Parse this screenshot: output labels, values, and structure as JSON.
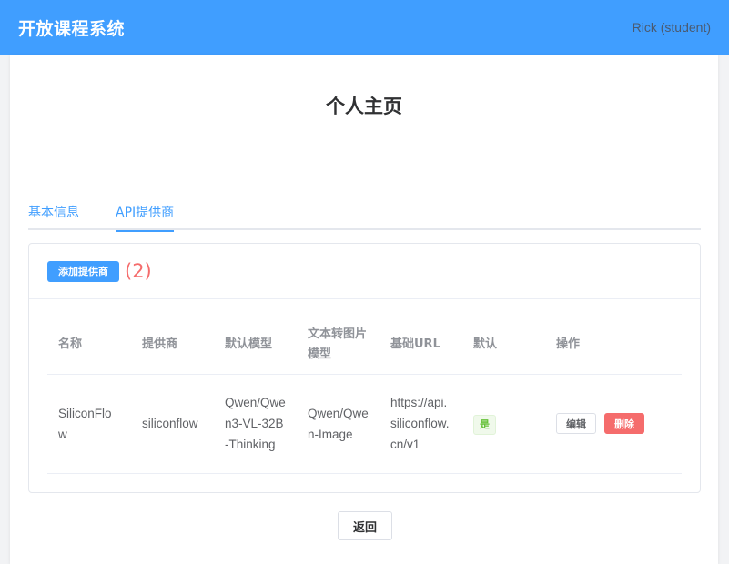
{
  "header": {
    "app_title": "开放课程系统",
    "user": "Rick (student)"
  },
  "page": {
    "title": "个人主页"
  },
  "tabs": [
    {
      "label": "基本信息",
      "active": false
    },
    {
      "label": "API提供商",
      "active": true
    }
  ],
  "providers_panel": {
    "add_button_label": "添加提供商",
    "count_note": "(2)",
    "columns": [
      "名称",
      "提供商",
      "默认模型",
      "文本转图片模型",
      "基础URL",
      "默认",
      "操作"
    ],
    "rows": [
      {
        "name": "SiliconFlow",
        "provider": "siliconflow",
        "default_model": "Qwen/Qwen3-VL-32B-Thinking",
        "text_to_image_model": "Qwen/Qwen-Image",
        "base_url": "https://api.siliconflow.cn/v1",
        "is_default": "是",
        "edit_label": "编辑",
        "delete_label": "删除"
      }
    ]
  },
  "footer": {
    "back_label": "返回"
  },
  "colors": {
    "primary": "#409eff",
    "danger": "#f56c6c",
    "success": "#67c23a"
  }
}
